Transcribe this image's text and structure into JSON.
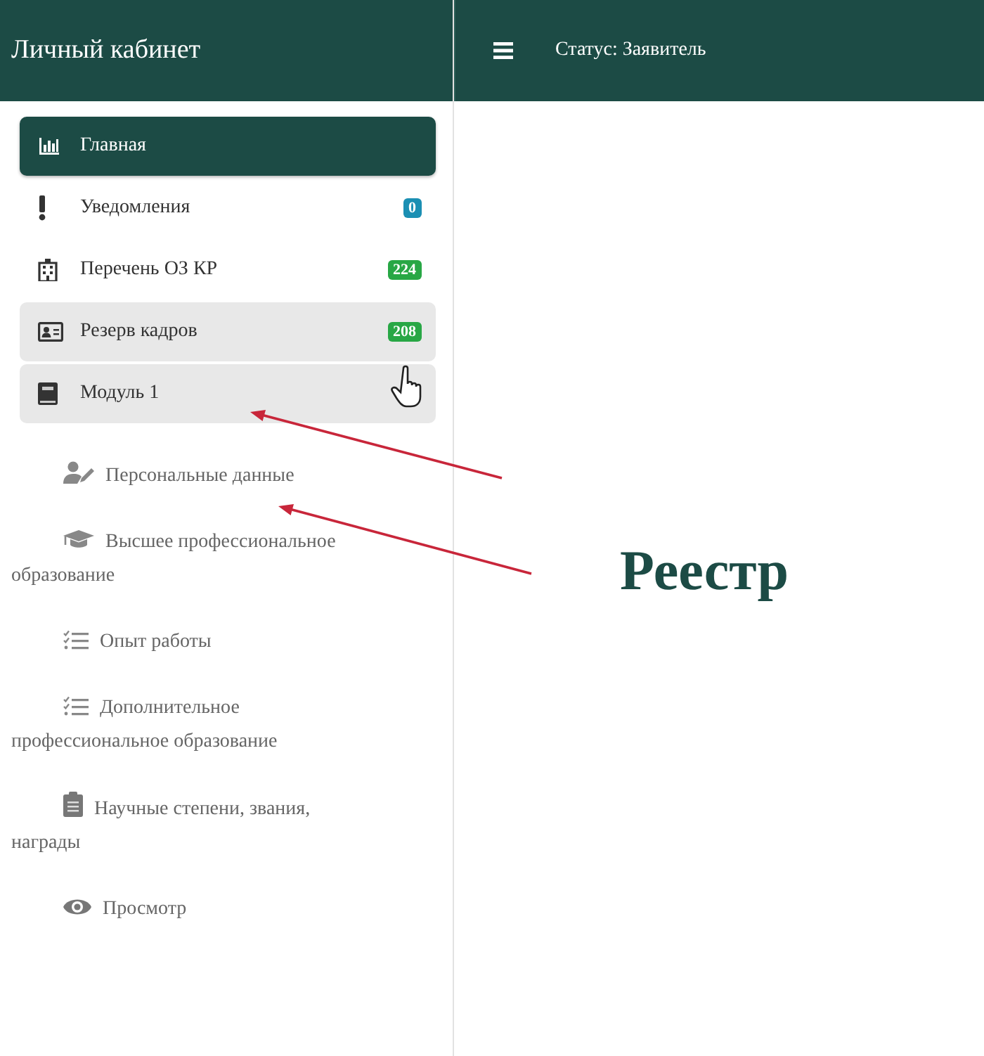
{
  "sidebar": {
    "title": "Личный кабинет",
    "items": [
      {
        "label": "Главная",
        "selected": true,
        "hovered": false,
        "expanded": false
      },
      {
        "label": "Уведомления",
        "selected": false,
        "hovered": false,
        "expanded": false,
        "badge": {
          "text": "0",
          "color": "#1b8fb3"
        }
      },
      {
        "label": "Перечень ОЗ КР",
        "selected": false,
        "hovered": false,
        "expanded": false,
        "badge": {
          "text": "224",
          "color": "#28a745"
        }
      },
      {
        "label": "Резерв кадров",
        "selected": false,
        "hovered": true,
        "expanded": false,
        "badge": {
          "text": "208",
          "color": "#28a745"
        }
      },
      {
        "label": "Модуль 1",
        "selected": false,
        "hovered": false,
        "expanded": true,
        "children": [
          {
            "label": "Персональные данные"
          },
          {
            "label": "Высшее профессиональное образование"
          },
          {
            "label": "Опыт работы"
          },
          {
            "label": "Дополнительное профессиональное образование"
          },
          {
            "label": "Научные степени, звания, награды"
          },
          {
            "label": "Просмотр"
          }
        ]
      }
    ]
  },
  "topbar": {
    "status": "Статус: Заявитель"
  },
  "main": {
    "heading": "Реестр"
  }
}
